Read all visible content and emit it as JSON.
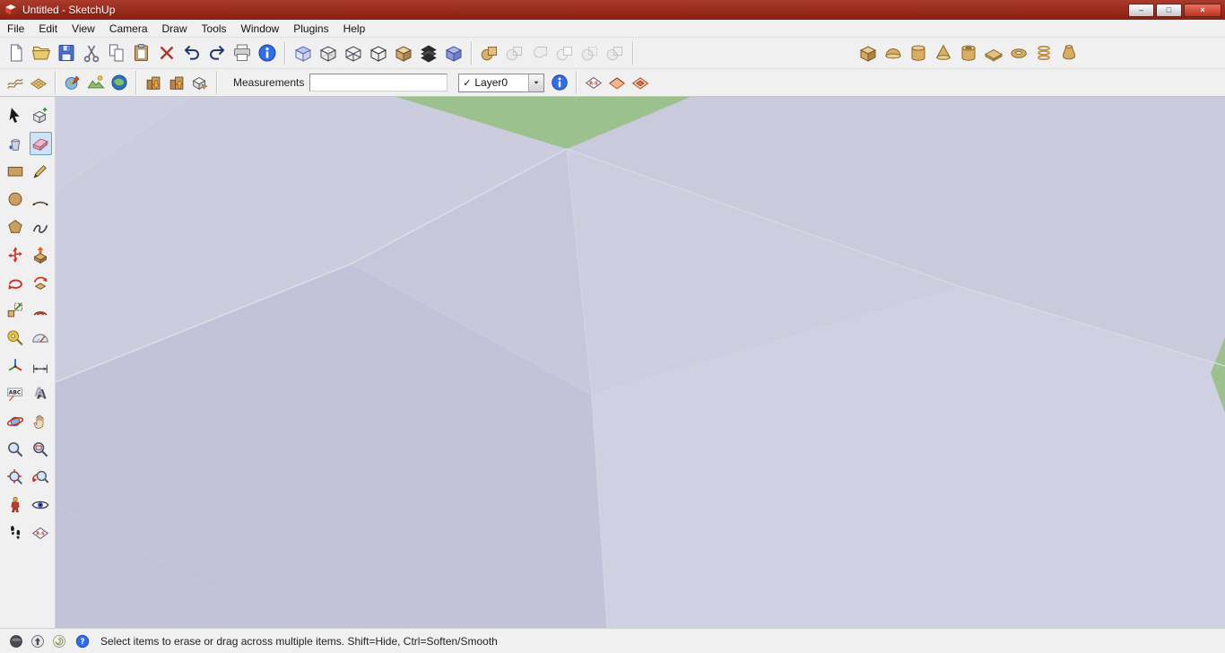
{
  "window": {
    "title": "Untitled - SketchUp",
    "controls": {
      "minimize": "–",
      "maximize": "□",
      "close": "×"
    }
  },
  "menu": {
    "items": [
      "File",
      "Edit",
      "View",
      "Camera",
      "Draw",
      "Tools",
      "Window",
      "Plugins",
      "Help"
    ]
  },
  "toolbars": {
    "row1": [
      {
        "group": "standard",
        "buttons": [
          {
            "name": "new-file-icon"
          },
          {
            "name": "open-icon"
          },
          {
            "name": "save-icon"
          },
          {
            "name": "cut-icon"
          },
          {
            "name": "copy-icon"
          },
          {
            "name": "paste-icon"
          },
          {
            "name": "delete-icon"
          },
          {
            "name": "undo-icon"
          },
          {
            "name": "redo-icon"
          },
          {
            "name": "print-icon"
          },
          {
            "name": "model-info-icon"
          }
        ]
      },
      {
        "group": "styles",
        "buttons": [
          {
            "name": "xray-icon"
          },
          {
            "name": "back-edges-icon"
          },
          {
            "name": "wireframe-icon"
          },
          {
            "name": "hidden-line-icon"
          },
          {
            "name": "shaded-icon"
          },
          {
            "name": "shaded-textures-icon"
          },
          {
            "name": "monochrome-icon"
          }
        ]
      },
      {
        "group": "solid-tools",
        "buttons": [
          {
            "name": "outer-shell-icon"
          },
          {
            "name": "intersect-icon",
            "disabled": true
          },
          {
            "name": "union-icon",
            "disabled": true
          },
          {
            "name": "subtract-icon",
            "disabled": true
          },
          {
            "name": "trim-icon",
            "disabled": true
          },
          {
            "name": "split-icon",
            "disabled": true
          }
        ]
      },
      {
        "group": "shapes",
        "buttons": [
          {
            "name": "shape-box-icon"
          },
          {
            "name": "shape-dome-icon"
          },
          {
            "name": "shape-cylinder-icon"
          },
          {
            "name": "shape-cone-icon"
          },
          {
            "name": "shape-tube-icon"
          },
          {
            "name": "shape-prism-icon"
          },
          {
            "name": "shape-torus-icon"
          },
          {
            "name": "shape-helix-icon"
          },
          {
            "name": "shape-pitcher-icon"
          }
        ]
      }
    ],
    "row2_left": [
      {
        "group": "sandbox",
        "buttons": [
          {
            "name": "sandbox-from-contours-icon"
          },
          {
            "name": "sandbox-from-scratch-icon"
          }
        ]
      },
      {
        "group": "google",
        "buttons": [
          {
            "name": "add-location-icon"
          },
          {
            "name": "toggle-terrain-icon"
          },
          {
            "name": "google-earth-icon"
          }
        ]
      },
      {
        "group": "warehouse",
        "buttons": [
          {
            "name": "get-models-icon"
          },
          {
            "name": "share-models-icon"
          },
          {
            "name": "share-component-icon"
          }
        ]
      }
    ],
    "sections": [
      {
        "group": "section",
        "buttons": [
          {
            "name": "section-plane-tool-icon"
          },
          {
            "name": "display-section-planes-icon"
          },
          {
            "name": "display-section-cuts-icon"
          }
        ]
      }
    ]
  },
  "measurements": {
    "label": "Measurements",
    "value": ""
  },
  "layers": {
    "checkmark": "✓",
    "current": "Layer0"
  },
  "palette": {
    "rows": [
      [
        {
          "name": "select-icon"
        },
        {
          "name": "make-component-icon"
        }
      ],
      [
        {
          "name": "paint-bucket-icon"
        },
        {
          "name": "eraser-icon",
          "selected": true
        }
      ],
      [
        {
          "name": "rectangle-icon"
        },
        {
          "name": "line-icon"
        }
      ],
      [
        {
          "name": "circle-icon"
        },
        {
          "name": "arc-icon"
        }
      ],
      [
        {
          "name": "polygon-icon"
        },
        {
          "name": "freehand-icon"
        }
      ],
      [
        {
          "name": "move-icon"
        },
        {
          "name": "push-pull-icon"
        }
      ],
      [
        {
          "name": "rotate-icon"
        },
        {
          "name": "follow-me-icon"
        }
      ],
      [
        {
          "name": "scale-icon"
        },
        {
          "name": "offset-icon"
        }
      ],
      [
        {
          "name": "tape-measure-icon"
        },
        {
          "name": "protractor-icon"
        }
      ],
      [
        {
          "name": "axes-icon"
        },
        {
          "name": "dimension-icon"
        }
      ],
      [
        {
          "name": "text-icon"
        },
        {
          "name": "3d-text-icon"
        }
      ],
      [
        {
          "name": "orbit-icon"
        },
        {
          "name": "pan-icon"
        }
      ],
      [
        {
          "name": "zoom-icon"
        },
        {
          "name": "zoom-window-icon"
        }
      ],
      [
        {
          "name": "zoom-extents-icon"
        },
        {
          "name": "previous-icon"
        }
      ],
      [
        {
          "name": "position-camera-icon"
        },
        {
          "name": "look-around-icon"
        }
      ],
      [
        {
          "name": "walk-icon"
        },
        {
          "name": "section-plane-icon"
        }
      ]
    ]
  },
  "statusbar": {
    "groups": [
      {
        "group": "status-geo",
        "buttons": [
          {
            "name": "status-globe-icon"
          },
          {
            "name": "status-upload-icon"
          },
          {
            "name": "status-swirl-icon"
          }
        ]
      },
      {
        "group": "status-help",
        "buttons": [
          {
            "name": "help-icon"
          }
        ]
      }
    ],
    "message": "Select items to erase or drag across multiple items. Shift=Hide, Ctrl=Soften/Smooth"
  },
  "canvas": {
    "active_tool": "Eraser",
    "colors": {
      "terrain_base": "#c8c9dd",
      "terrain_light": "#cfd0e2",
      "terrain_dark": "#c2c3d8",
      "ground_green": "#9dc18c",
      "titlebar_red": "#8f2016"
    }
  }
}
